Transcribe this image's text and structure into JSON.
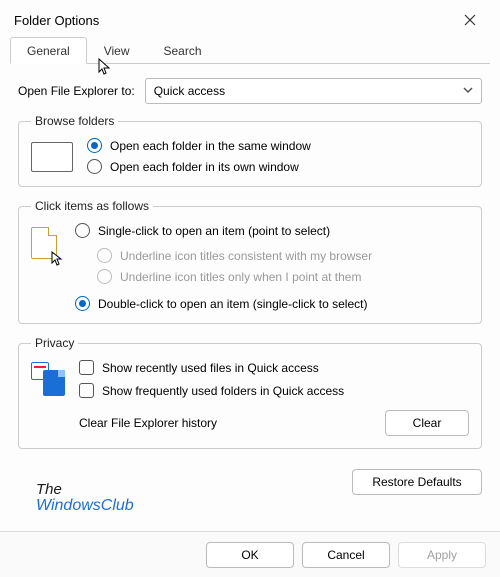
{
  "window": {
    "title": "Folder Options"
  },
  "tabs": {
    "general": "General",
    "view": "View",
    "search": "Search",
    "active": "general"
  },
  "open_explorer": {
    "label": "Open File Explorer to:",
    "value": "Quick access"
  },
  "browse": {
    "legend": "Browse folders",
    "same": "Open each folder in the same window",
    "own": "Open each folder in its own window",
    "selected": "same"
  },
  "click": {
    "legend": "Click items as follows",
    "single": "Single-click to open an item (point to select)",
    "underline_browser": "Underline icon titles consistent with my browser",
    "underline_point": "Underline icon titles only when I point at them",
    "double": "Double-click to open an item (single-click to select)",
    "selected": "double"
  },
  "privacy": {
    "legend": "Privacy",
    "recent_files": "Show recently used files in Quick access",
    "frequent_folders": "Show frequently used folders in Quick access",
    "clear_label": "Clear File Explorer history",
    "clear_btn": "Clear"
  },
  "buttons": {
    "restore": "Restore Defaults",
    "ok": "OK",
    "cancel": "Cancel",
    "apply": "Apply"
  },
  "branding": {
    "line1": "The",
    "line2": "WindowsClub"
  }
}
